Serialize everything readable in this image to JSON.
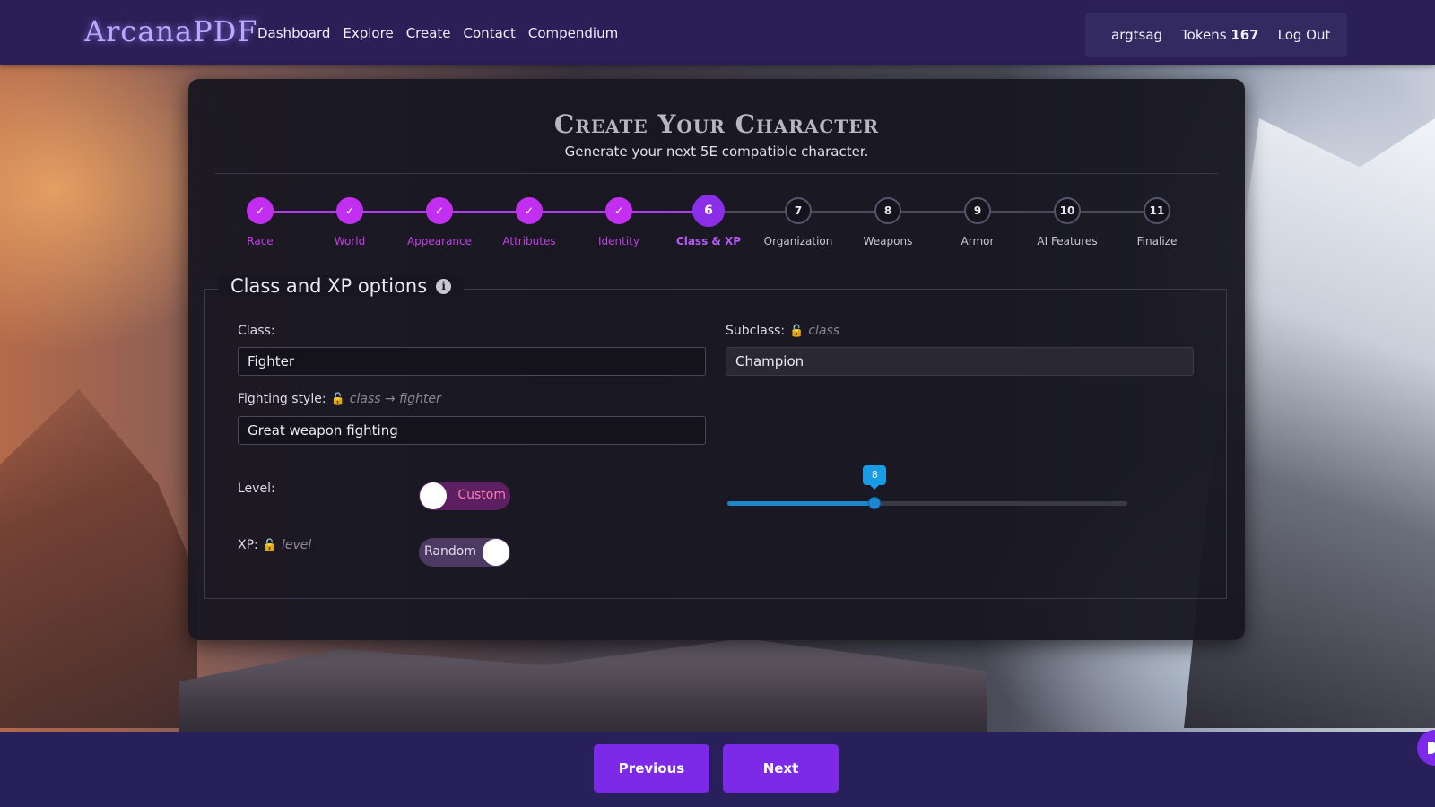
{
  "brand": {
    "name": "ArcanaPDF"
  },
  "nav": [
    "Dashboard",
    "Explore",
    "Create",
    "Contact",
    "Compendium"
  ],
  "user": {
    "username": "argtsag",
    "tokens_label": "Tokens",
    "tokens_value": "167",
    "logout": "Log Out"
  },
  "card": {
    "title": "Create Your Character",
    "subtitle": "Generate your next 5E compatible character."
  },
  "steps": [
    {
      "label": "Race",
      "state": "done"
    },
    {
      "label": "World",
      "state": "done"
    },
    {
      "label": "Appearance",
      "state": "done"
    },
    {
      "label": "Attributes",
      "state": "done"
    },
    {
      "label": "Identity",
      "state": "done"
    },
    {
      "label": "Class & XP",
      "state": "active",
      "number": "6"
    },
    {
      "label": "Organization",
      "state": "todo",
      "number": "7"
    },
    {
      "label": "Weapons",
      "state": "todo",
      "number": "8"
    },
    {
      "label": "Armor",
      "state": "todo",
      "number": "9"
    },
    {
      "label": "AI Features",
      "state": "todo",
      "number": "10"
    },
    {
      "label": "Finalize",
      "state": "todo",
      "number": "11"
    }
  ],
  "section": {
    "title": "Class and XP options",
    "class_label": "Class:",
    "class_value": "Fighter",
    "subclass_label": "Subclass:",
    "subclass_hint": "class",
    "subclass_value": "Champion",
    "fighting_style_label": "Fighting style:",
    "fighting_style_hint": "class → fighter",
    "fighting_style_value": "Great weapon fighting",
    "level_label": "Level:",
    "level_toggle": "Custom",
    "xp_label": "XP:",
    "xp_hint": "level",
    "xp_toggle": "Random",
    "level_slider": {
      "value": 8,
      "min": 1,
      "max": 20
    }
  },
  "footer": {
    "previous": "Previous",
    "next": "Next"
  },
  "colors": {
    "accent": "#7d2ae8",
    "step_done": "#c22ff0",
    "tokens": "#3ee58a",
    "slider": "#1d87d4"
  }
}
